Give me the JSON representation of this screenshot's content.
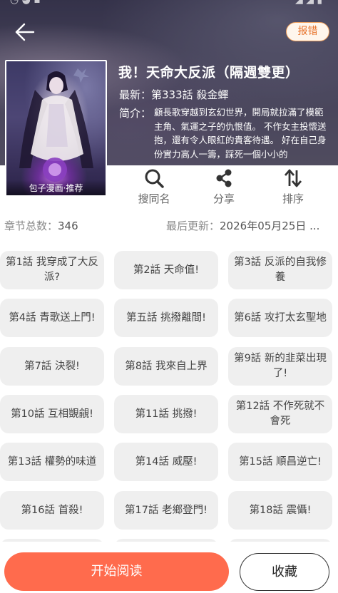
{
  "header": {
    "report_label": "报错",
    "cover_caption": "包子漫画·推荐",
    "title": "我！天命大反派（隔週雙更）",
    "latest_label": "最新：",
    "latest_value": "第333話 殺金蟬",
    "description_label": "简介：",
    "description": "顧長歌穿越到玄幻世界，開局就拉滿了模範主角、氣運之子的仇恨值。 不作女主投懷送抱，還有令人眼紅的貴客待遇。 好在自己身份實力高人一籌，踩死一個小小的"
  },
  "actions": [
    {
      "label": "搜同名",
      "icon": "search-icon"
    },
    {
      "label": "分享",
      "icon": "share-icon"
    },
    {
      "label": "排序",
      "icon": "sort-icon"
    }
  ],
  "info": {
    "total_label": "章节总数：",
    "total_value": "346",
    "updated_label": "最后更新：",
    "updated_value": "2026年05月25日 ..."
  },
  "chapters": [
    "第1話 我穿成了大反派?",
    "第2話 天命值!",
    "第3話 反派的自我修養",
    "第4話 青歌送上門!",
    "第五話 挑撥離間!",
    "第6話 攻打太玄聖地",
    "第7話 決裂!",
    "第8話 我來自上界",
    "第9話 新的韭菜出現了!",
    "第10話 互相覬覦!",
    "第11話 挑撥!",
    "第12話 不作死就不會死",
    "第13話 權勢的味道",
    "第14話 威壓!",
    "第15話 順昌逆亡!",
    "第16話 首殺!",
    "第17話 老鄉登門!",
    "第18話 震懾!"
  ],
  "footer": {
    "read_label": "开始阅读",
    "favorite_label": "收藏"
  },
  "colors": {
    "accent": "#ff6b4d",
    "report": "#e8742c",
    "chip": "#efefef"
  }
}
